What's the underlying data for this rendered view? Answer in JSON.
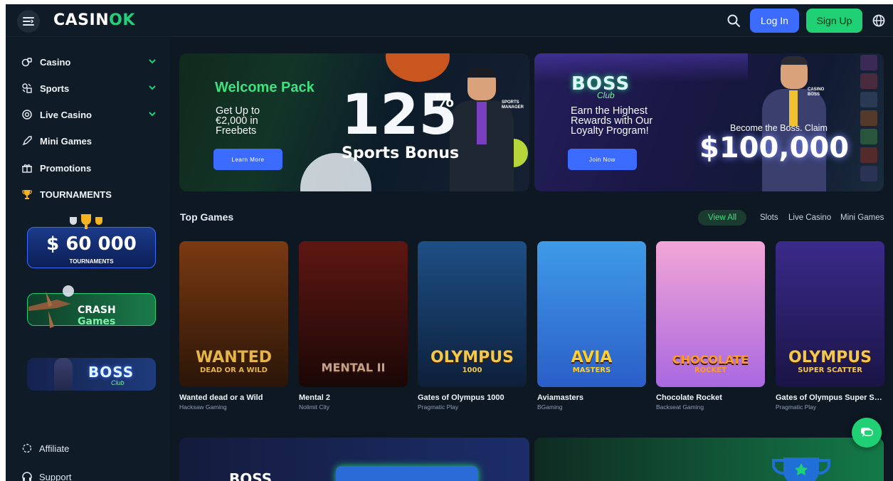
{
  "header": {
    "logo_main": "CASIN",
    "logo_accent": "OK",
    "login_label": "Log In",
    "signup_label": "Sign Up"
  },
  "sidebar": {
    "items": [
      {
        "label": "Casino",
        "icon": "casino-icon",
        "expandable": true
      },
      {
        "label": "Sports",
        "icon": "sports-icon",
        "expandable": true
      },
      {
        "label": "Live Casino",
        "icon": "live-casino-icon",
        "expandable": true
      },
      {
        "label": "Mini Games",
        "icon": "rocket-icon",
        "expandable": false
      },
      {
        "label": "Promotions",
        "icon": "gift-icon",
        "expandable": false
      },
      {
        "label": "TOURNAMENTS",
        "icon": "trophy-icon",
        "expandable": false
      }
    ],
    "promos": {
      "tournament_amount": "$ 60 000",
      "tournament_caption": "TOURNAMENTS",
      "crash_text": "CRASH",
      "crash_text_accent": "Games",
      "boss_text": "BOSS",
      "boss_sub": "Club"
    },
    "footer": [
      {
        "label": "Affiliate",
        "icon": "affiliate-icon"
      },
      {
        "label": "Support",
        "icon": "headset-icon"
      }
    ]
  },
  "banners": {
    "welcome": {
      "title": "Welcome Pack",
      "sub_line1": "Get Up to",
      "sub_line2": "€2,000 in",
      "sub_line3": "Freebets",
      "button": "Learn More",
      "big_number": "125",
      "percent": "%",
      "bonus": "Sports Bonus",
      "tag_line1": "SPORTS",
      "tag_line2": "MANAGER"
    },
    "boss": {
      "logo": "BOSS",
      "logo_sub": "Club",
      "sub_line1": "Earn the Highest",
      "sub_line2": "Rewards with Our",
      "sub_line3": "Loyalty Program!",
      "button": "Join Now",
      "claim": "Become the Boss. Claim",
      "amount": "$100,000",
      "tag_line1": "CASINO",
      "tag_line2": "BOSS"
    }
  },
  "top_games": {
    "title": "Top Games",
    "filters": [
      "View All",
      "Slots",
      "Live Casino",
      "Mini Games"
    ],
    "games": [
      {
        "name": "Wanted dead or a Wild",
        "provider": "Hacksaw Gaming",
        "art": "WANTED",
        "art_sub": "DEAD OR A WILD",
        "bg1": "#7a3a12",
        "bg2": "#2a1508",
        "fg": "#e6b54a"
      },
      {
        "name": "Mental 2",
        "provider": "Nolimit City",
        "art": "MENTAL II",
        "art_sub": "",
        "bg1": "#5e1712",
        "bg2": "#1a0706",
        "fg": "#c7a088"
      },
      {
        "name": "Gates of Olympus 1000",
        "provider": "Pragmatic Play",
        "art": "OLYMPUS",
        "art_sub": "1000",
        "bg1": "#1d4f86",
        "bg2": "#0d1f3a",
        "fg": "#f3c84b"
      },
      {
        "name": "Aviamasters",
        "provider": "BGaming",
        "art": "AVIA",
        "art_sub": "MASTERS",
        "bg1": "#3f9be8",
        "bg2": "#2a5ec8",
        "fg": "#ffcf2e"
      },
      {
        "name": "Chocolate Rocket",
        "provider": "Backseat Gaming",
        "art": "CHOCOLATE",
        "art_sub": "ROCKET",
        "bg1": "#f2a6d6",
        "bg2": "#a968e0",
        "fg": "#ff9b22"
      },
      {
        "name": "Gates of Olympus Super Scatter",
        "provider": "Pragmatic Play",
        "art": "OLYMPUS",
        "art_sub": "SUPER SCATTER",
        "bg1": "#3b2a8a",
        "bg2": "#1a1446",
        "fg": "#f3c84b"
      }
    ]
  },
  "bottom": {
    "boss_text": "BOSS"
  }
}
